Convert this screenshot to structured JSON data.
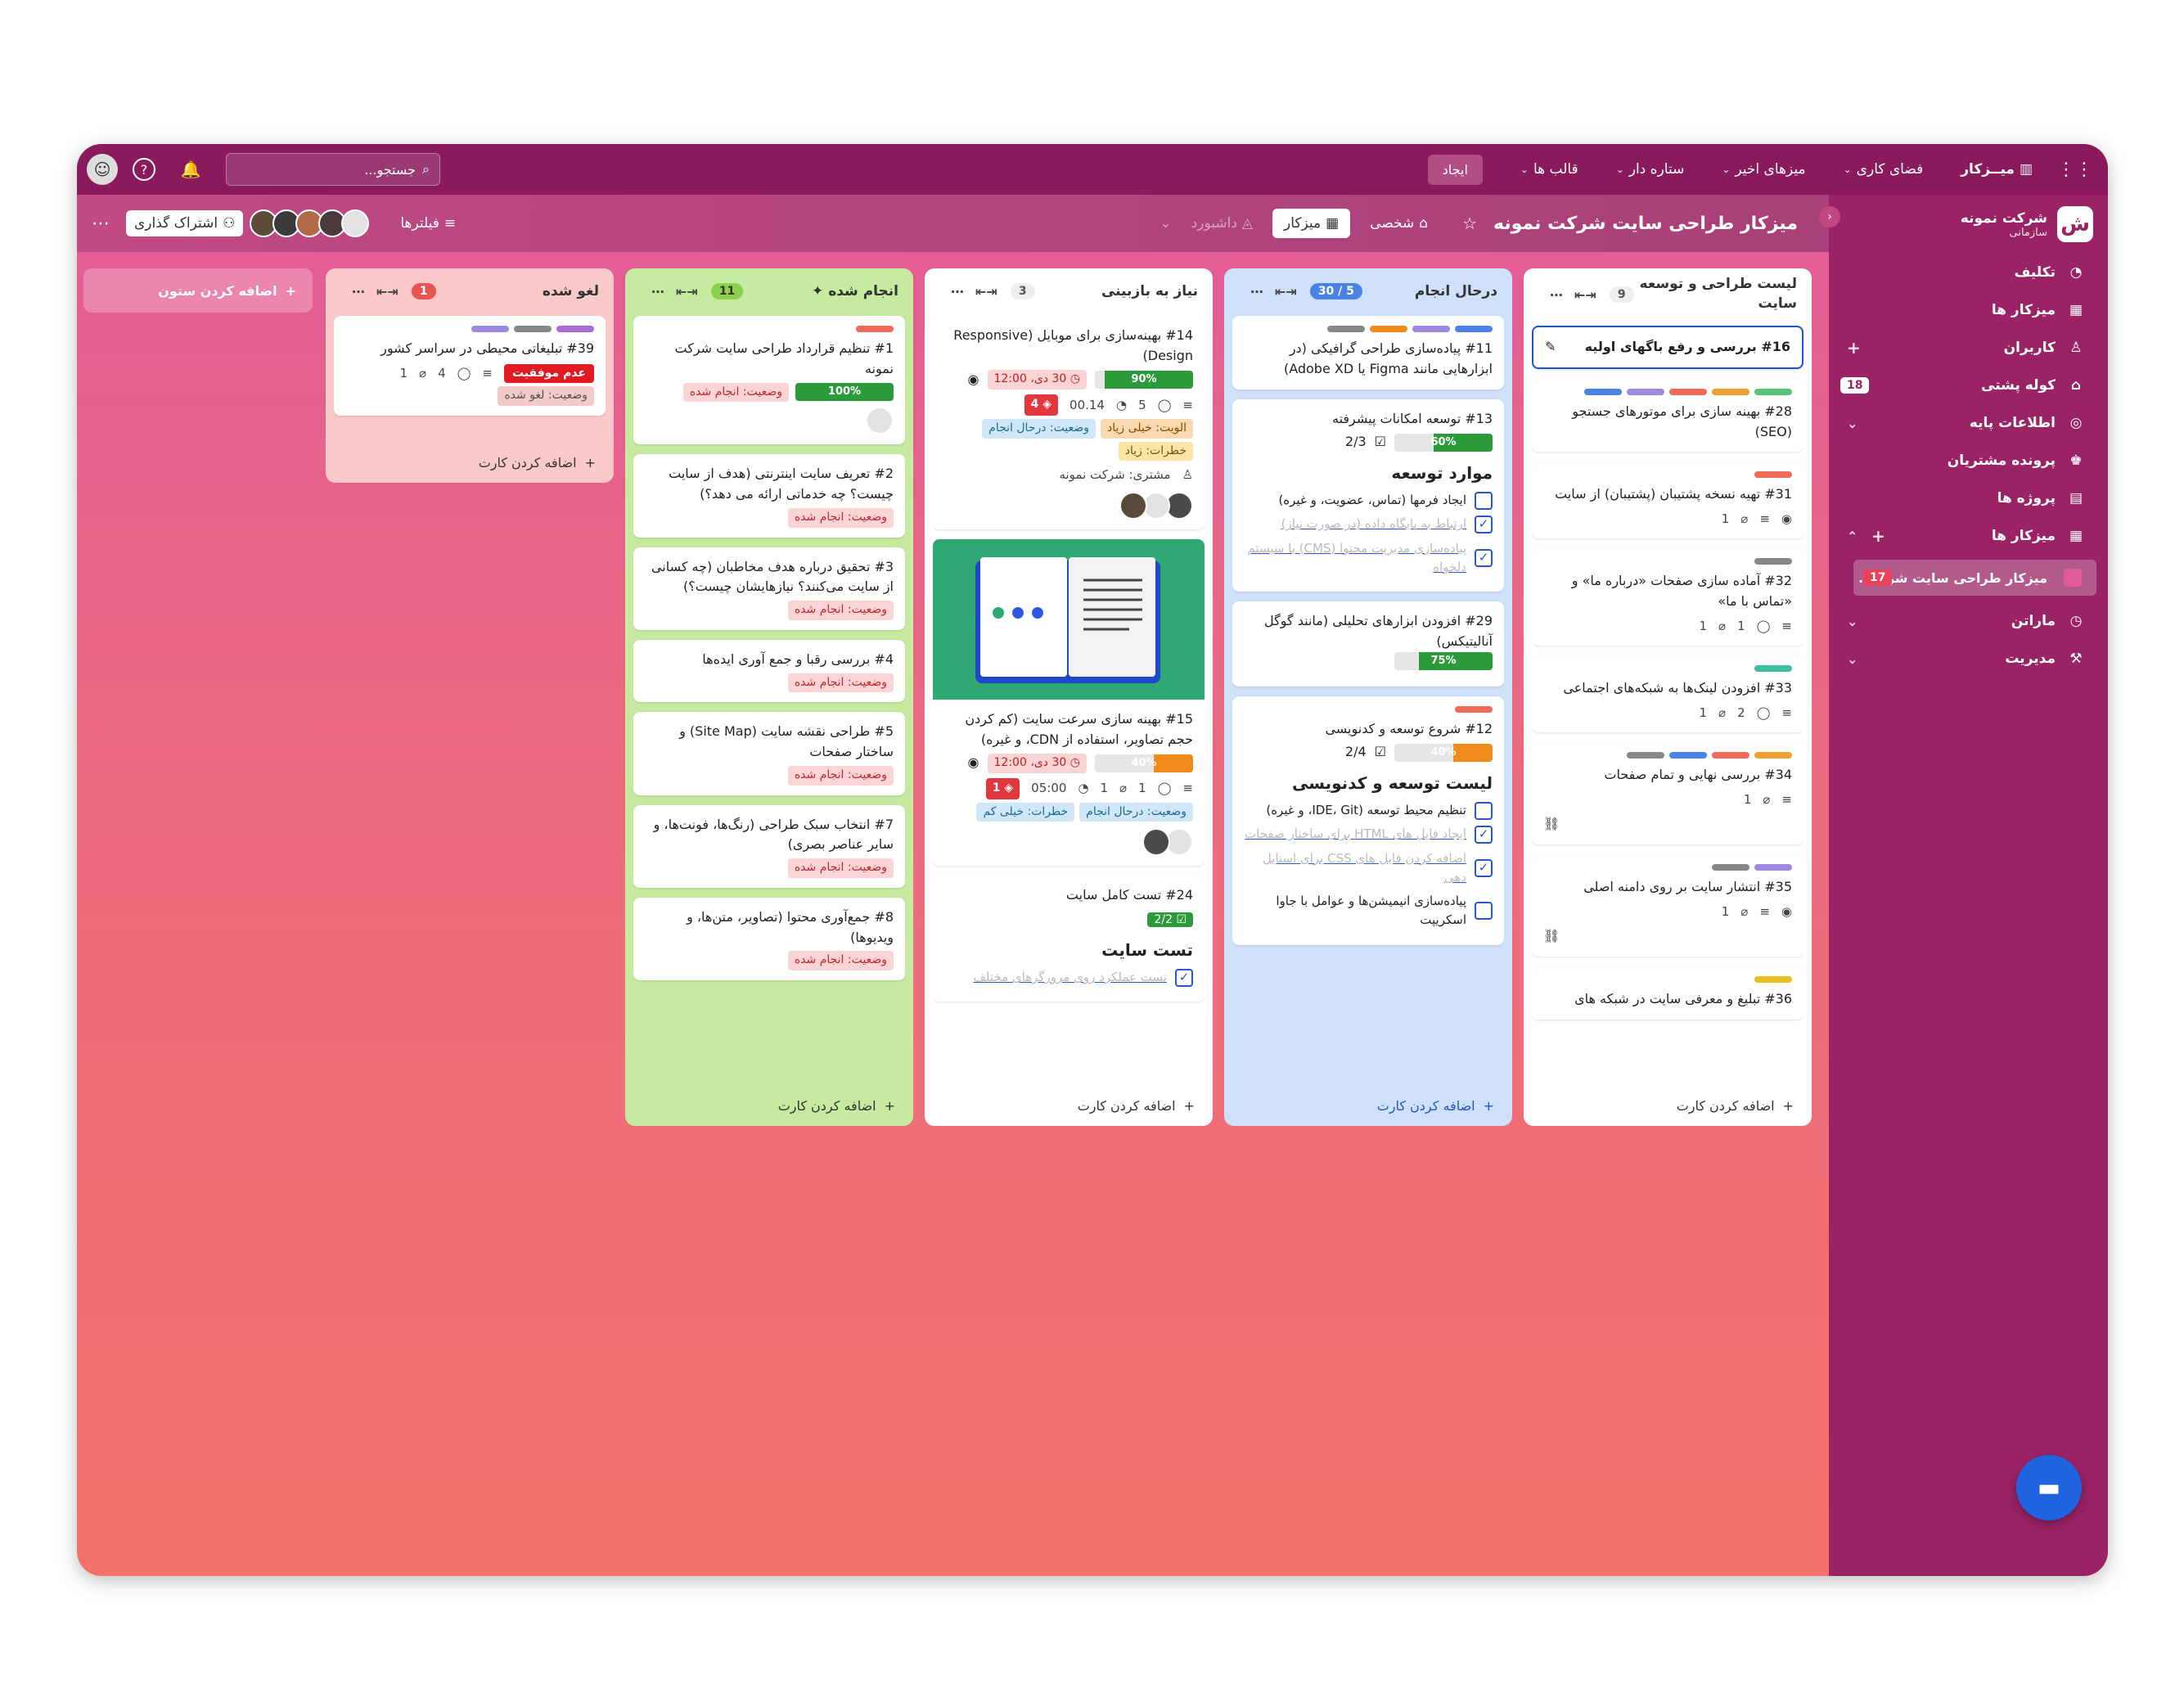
{
  "topbar": {
    "logo": "میــزکار",
    "menus": [
      "فضای کاری",
      "میزهای اخیر",
      "ستاره دار",
      "قالب ها"
    ],
    "create": "ایجاد",
    "search_placeholder": "جستجو..."
  },
  "subbar": {
    "board_title": "میزکار طراحی سایت شرکت نمونه",
    "personal": "شخصی",
    "view_board": "میزکار",
    "view_dashboard": "داشبورد",
    "filters": "فیلترها",
    "share": "اشتراک گذاری"
  },
  "sidebar": {
    "org_name": "شرکت نمونه",
    "org_type": "سازمانی",
    "logo_letter": "ش",
    "items": [
      {
        "label": "تکلیف",
        "icon": "task-icon"
      },
      {
        "label": "میزکار ها",
        "icon": "board-icon"
      },
      {
        "label": "کاربران",
        "icon": "user-icon"
      },
      {
        "label": "کوله پشتی",
        "icon": "backpack-icon",
        "badge": "18"
      },
      {
        "label": "اطلاعات پایه",
        "icon": "settings-icon"
      },
      {
        "label": "پرونده مشتریان",
        "icon": "customers-icon"
      },
      {
        "label": "پروژه ها",
        "icon": "project-icon"
      },
      {
        "label": "میزکار ها",
        "icon": "board-icon"
      }
    ],
    "active_board": "میزکار طراحی سایت شرک...",
    "active_board_count": "17",
    "bottom_items": [
      {
        "label": "ماراتن",
        "icon": "clock-icon"
      },
      {
        "label": "مدیریت",
        "icon": "wrench-icon"
      }
    ]
  },
  "add_column": "اضافه کردن ستون",
  "add_card": "اضافه کردن کارت",
  "columns": {
    "backlog": {
      "name": "لیست طراحی و توسعه سایت",
      "count": "9",
      "cards": {
        "c16": "#16 بررسی و رفع باگهای اولیه",
        "c28": "#28 بهینه سازی برای موتورهای جستجو (SEO)",
        "c31": "#31 تهیه نسخه پشتیبان (پشتیبان) از سایت",
        "c31_meta": "1",
        "c32": "#32 آماده سازی صفحات «درباره ما» و «تماس با ما»",
        "c32_m1": "1",
        "c32_m2": "1",
        "c33": "#33 افزودن لینک‌ها به شبکه‌های اجتماعی",
        "c33_m1": "1",
        "c33_m2": "2",
        "c34": "#34 بررسی نهایی و تمام صفحات",
        "c34_m1": "1",
        "c35": "#35 انتشار سایت بر روی دامنه اصلی",
        "c35_m1": "1",
        "c36": "#36 تبلیغ و معرفی سایت در شبکه های"
      }
    },
    "doing": {
      "name": "درحال انجام",
      "count": "5 / 30",
      "cards": {
        "c11": "#11 پیاده‌سازی طراحی گرافیکی (در ابزارهایی مانند Figma یا Adobe XD)",
        "c13": "#13 توسعه امکانات پیشرفته",
        "c13_chk": "2/3",
        "c13_prog": "60%",
        "c13_section": "موارد توسعه",
        "c13_i1": "ایجاد فرمها (تماس، عضویت، و غیره)",
        "c13_i2": "ارتباط به پایگاه داده (در صورت نیاز)",
        "c13_i3": "پیاده‌سازی مدیریت محتوا (CMS) با سیستم دلخواه",
        "c29": "#29 افزودن ابزارهای تحلیلی (مانند گوگل آنالیتیکس)",
        "c29_prog": "75%",
        "c12": "#12 شروع توسعه و کدنویسی",
        "c12_chk": "2/4",
        "c12_prog": "40%",
        "c12_section": "لیست توسعه و کدنویسی",
        "c12_i1": "تنظیم محیط توسعه (IDE، Git، و غیره)",
        "c12_i2": "ایجاد فایل های HTML برای ساختار صفحات",
        "c12_i3": "اضافه کردن فایل های CSS برای استایل دهی",
        "c12_i4": "پیاده‌سازی انیمیشن‌ها و عوامل با جاوا اسکریپت"
      }
    },
    "review": {
      "name": "نیاز به بازبینی",
      "count": "3",
      "cards": {
        "c14": "#14 بهینه‌سازی برای موبایل (Responsive Design)",
        "c14_prog": "90%",
        "c14_date": "30 دی، 12:00",
        "c14_time": "00.14",
        "c14_comments": "5",
        "c14_risk": "4",
        "c14_tag1": "الویت: خیلی زیاد",
        "c14_tag2": "وضعیت: درحال انجام",
        "c14_tag3": "خطرات: زیاد",
        "c14_customer": "مشتری: شرکت نمونه",
        "c15": "#15 بهینه سازی سرعت سایت (کم کردن حجم تصاویر، استفاده از CDN، و غیره)",
        "c15_prog": "40%",
        "c15_date": "30 دی، 12:00",
        "c15_time": "05:00",
        "c15_m1": "1",
        "c15_m2": "1",
        "c15_risk": "1",
        "c15_tag1": "وضعیت: درحال انجام",
        "c15_tag2": "خطرات: خیلی کم",
        "c24": "#24 تست کامل سایت",
        "c24_chk": "2/2",
        "c24_section": "تست سایت",
        "c24_i1": "تست عملکرد روی مرورگرهای مختلف"
      }
    },
    "done": {
      "name": "انجام شده",
      "count": "11",
      "cards": {
        "c1": "#1 تنظیم قرارداد طراحی سایت شرکت نمونه",
        "c1_prog": "100%",
        "c1_status": "وضعیت: انجام شده",
        "c2": "#2 تعریف سایت اینترنتی (هدف از سایت چیست؟ چه خدماتی ارائه می دهد؟)",
        "c3": "#3 تحقیق درباره هدف مخاطبان (چه کسانی از سایت می‌کنند؟ نیازهایشان چیست؟)",
        "c4": "#4 بررسی رقبا و جمع آوری ایده‌ها",
        "c5": "#5 طراحی نقشه سایت (Site Map) و ساختار صفحات",
        "c7": "#7 انتخاب سبک طراحی (رنگ‌ها، فونت‌ها، و سایر عناصر بصری)",
        "c8": "#8 جمع‌آوری محتوا (تصاویر، متن‌ها، و ویدیوها)",
        "status": "وضعیت: انجام شده"
      }
    },
    "cancel": {
      "name": "لغو شده",
      "count": "1",
      "cards": {
        "c39": "#39 تبلیغاتی محیطی در سراسر کشور",
        "c39_fail": "عدم موفقیت",
        "c39_m1": "4",
        "c39_m2": "1",
        "c39_status": "وضعیت: لغو شده"
      }
    }
  },
  "colors": {
    "topbar": "#8a1a5c",
    "sidebar": "#9a2366",
    "col_backlog": "#ffffff",
    "col_doing": "#cfe0fb",
    "col_review": "#ffffff",
    "col_done": "#c6eba0",
    "col_cancel": "#fbc9c9"
  }
}
